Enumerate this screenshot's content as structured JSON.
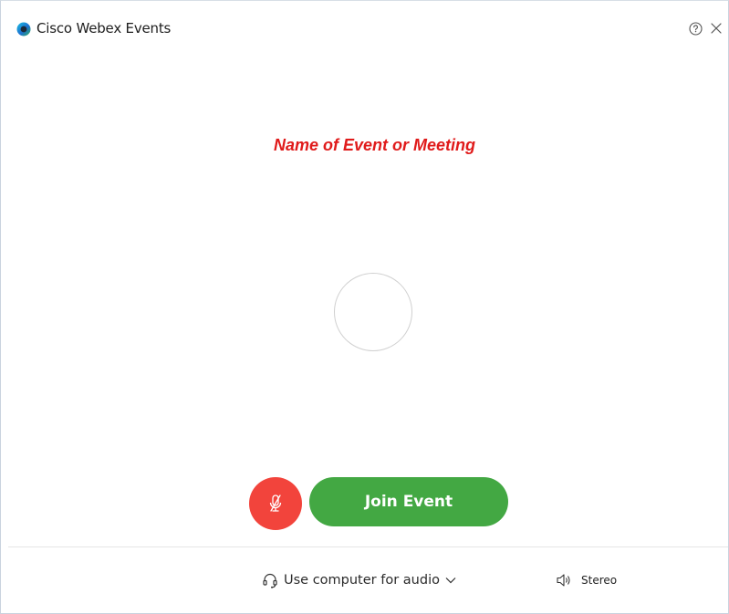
{
  "window": {
    "title": "Cisco Webex Events"
  },
  "meeting": {
    "name": "Name of Event or Meeting"
  },
  "controls": {
    "join_label": "Join Event"
  },
  "audio": {
    "connection_label": "Use computer for audio",
    "output_label": "Stereo"
  },
  "icons": {
    "app_logo": "webex-logo-icon",
    "help": "help-icon",
    "close": "close-icon",
    "mute": "microphone-muted-icon",
    "headset": "headset-icon",
    "chevron": "chevron-down-icon",
    "speaker": "speaker-icon"
  },
  "colors": {
    "event_name": "#e01b1b",
    "mute_button": "#f2443c",
    "join_button": "#43a843"
  }
}
